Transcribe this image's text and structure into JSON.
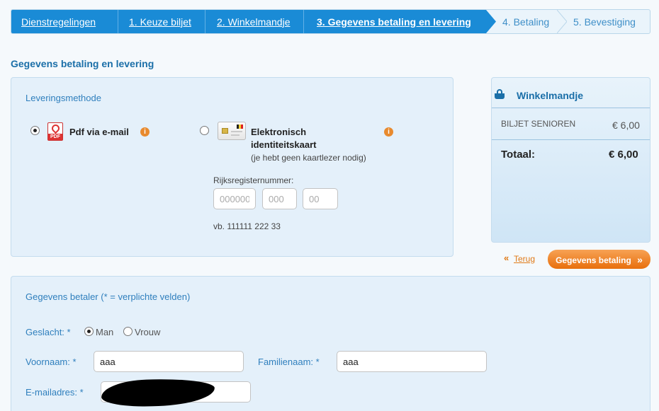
{
  "steps": [
    {
      "label": "Dienstregelingen",
      "state": "done"
    },
    {
      "label": "1. Keuze biljet",
      "state": "done"
    },
    {
      "label": "2. Winkelmandje",
      "state": "done"
    },
    {
      "label": "3. Gegevens betaling en levering",
      "state": "active"
    },
    {
      "label": "4. Betaling",
      "state": "future"
    },
    {
      "label": "5. Bevestiging",
      "state": "future"
    }
  ],
  "page_title": "Gegevens betaling en levering",
  "delivery": {
    "heading": "Leveringsmethode",
    "pdf_label": "Pdf via e-mail",
    "pdf_icon_text": "PDF",
    "eid_label_line1": "Elektronisch",
    "eid_label_line2": "identiteitskaart",
    "eid_note": "(je hebt geen kaartlezer nodig)",
    "rrn_label": "Rijksregisternummer:",
    "rrn_placeholders": [
      "000000",
      "000",
      "00"
    ],
    "rrn_example": "vb. 111111 222 33",
    "selected": "pdf",
    "info_glyph": "i"
  },
  "basket": {
    "title": "Winkelmandje",
    "item_label": "BILJET SENIOREN",
    "item_price": "€ 6,00",
    "total_label": "Totaal:",
    "total_price": "€ 6,00"
  },
  "nav": {
    "back_label": "Terug",
    "back_glyph": "«",
    "next_label": "Gegevens betaling",
    "next_glyph": "»"
  },
  "payer": {
    "heading": "Gegevens betaler (* = verplichte velden)",
    "gender_label": "Geslacht: *",
    "gender_man": "Man",
    "gender_woman": "Vrouw",
    "gender_selected": "man",
    "firstname_label": "Voornaam: *",
    "firstname_value": "aaa",
    "lastname_label": "Familienaam: *",
    "lastname_value": "aaa",
    "email_label": "E-mailadres: *"
  },
  "colors": {
    "accent": "#1a8bd6",
    "orange": "#e86f0c",
    "panel": "#e4f0fa"
  }
}
